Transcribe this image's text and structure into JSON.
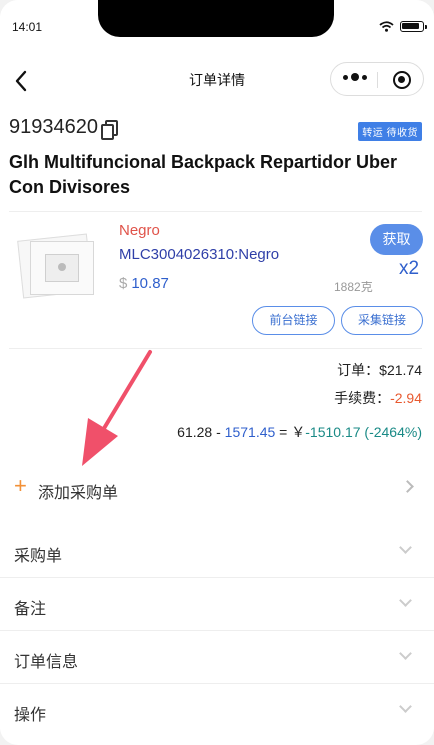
{
  "status_bar": {
    "time": "14:01"
  },
  "nav": {
    "title": "订单详情"
  },
  "order": {
    "id": "91934620",
    "status_badge": "转运 待收货",
    "product_title": "Glh Multifuncional Backpack Repartidor Uber Con Divisores",
    "item": {
      "variant": "Negro",
      "sku": "MLC3004026310:Negro",
      "currency_symbol": "$",
      "price": "10.87",
      "weight": "1882克",
      "fetch_label": "获取",
      "quantity": "x2",
      "front_link_label": "前台链接",
      "collect_link_label": "采集链接"
    },
    "summary": {
      "order_label": "订单：",
      "order_value": "$21.74",
      "fee_label": "手续费：",
      "fee_value": "-2.94",
      "calc_a": "61.28",
      "calc_minus": " - ",
      "calc_b": "1571.45",
      "calc_eq": " = ￥",
      "calc_result": "-1510.17 (-2464%)"
    }
  },
  "add_purchase": {
    "icon": "+",
    "label": "添加采购单"
  },
  "sections": [
    {
      "label": "采购单"
    },
    {
      "label": "备注"
    },
    {
      "label": "订单信息"
    },
    {
      "label": "操作"
    }
  ],
  "colors": {
    "accent_blue": "#5a8ee8",
    "badge_blue": "#3f7fe6",
    "variant_red": "#e0534a",
    "fee_orange": "#e8592f",
    "result_teal": "#1a8a86",
    "plus_orange": "#f29037",
    "annotation_arrow": "#f0506a"
  },
  "icons": [
    "back-arrow-icon",
    "more-dots-icon",
    "target-icon",
    "copy-icon",
    "chevron-right-icon",
    "chevron-down-icon",
    "wifi-icon",
    "battery-icon",
    "image-placeholder-icon"
  ]
}
